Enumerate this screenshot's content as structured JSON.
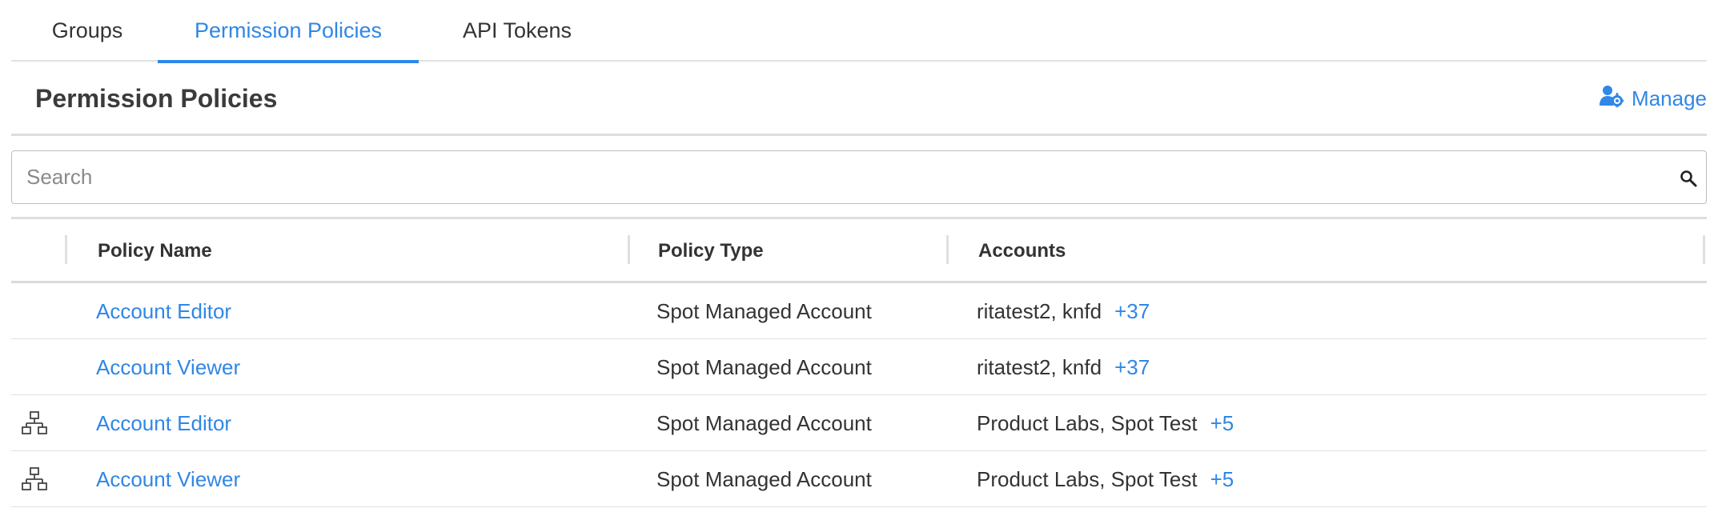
{
  "tabs": [
    {
      "label": "Groups"
    },
    {
      "label": "Permission Policies",
      "active": true
    },
    {
      "label": "API Tokens"
    }
  ],
  "header": {
    "title": "Permission Policies",
    "manage_label": "Manage",
    "manage_icon": "user-cog-icon"
  },
  "search": {
    "placeholder": "Search",
    "value": "",
    "icon": "search-icon"
  },
  "table": {
    "columns": [
      "Policy Name",
      "Policy Type",
      "Accounts"
    ],
    "rows": [
      {
        "hierarchy_icon": false,
        "name": "Account Editor",
        "type": "Spot Managed Account",
        "accounts": "ritatest2, knfd",
        "more": "+37"
      },
      {
        "hierarchy_icon": false,
        "name": "Account Viewer",
        "type": "Spot Managed Account",
        "accounts": "ritatest2, knfd",
        "more": "+37"
      },
      {
        "hierarchy_icon": true,
        "name": "Account Editor",
        "type": "Spot Managed Account",
        "accounts": "Product Labs, Spot Test",
        "more": "+5"
      },
      {
        "hierarchy_icon": true,
        "name": "Account Viewer",
        "type": "Spot Managed Account",
        "accounts": "Product Labs, Spot Test",
        "more": "+5"
      }
    ]
  },
  "colors": {
    "accent": "#3087e6",
    "text": "#333333",
    "border": "#dedede"
  }
}
